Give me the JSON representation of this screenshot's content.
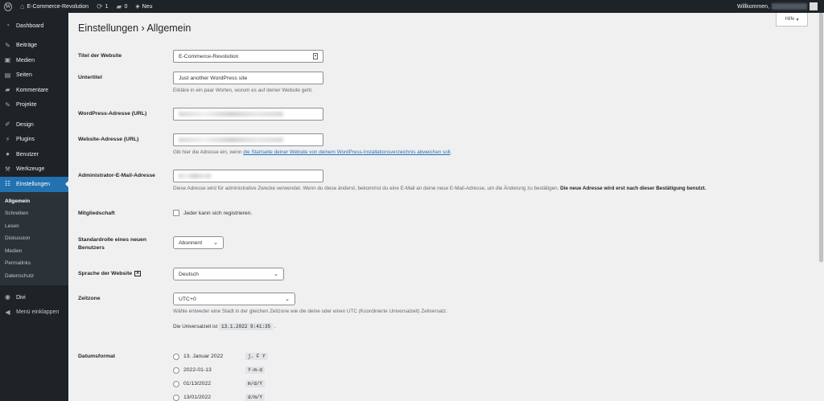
{
  "adminbar": {
    "site_name": "E-Commerce-Revolution",
    "updates_count": "1",
    "comments_count": "0",
    "new_label": "Neu",
    "welcome": "Willkommen,"
  },
  "sidebar": {
    "items": [
      {
        "label": "Dashboard",
        "icon": "dashboard-icon"
      },
      {
        "label": "Beiträge",
        "icon": "pin-icon"
      },
      {
        "label": "Medien",
        "icon": "media-icon"
      },
      {
        "label": "Seiten",
        "icon": "pages-icon"
      },
      {
        "label": "Kommentare",
        "icon": "comment-icon"
      },
      {
        "label": "Projekte",
        "icon": "pin-icon"
      },
      {
        "label": "Design",
        "icon": "brush-icon"
      },
      {
        "label": "Plugins",
        "icon": "plugin-icon"
      },
      {
        "label": "Benutzer",
        "icon": "user-icon"
      },
      {
        "label": "Werkzeuge",
        "icon": "wrench-icon"
      },
      {
        "label": "Einstellungen",
        "icon": "settings-icon"
      }
    ],
    "submenu": [
      "Allgemein",
      "Schreiben",
      "Lesen",
      "Diskussion",
      "Medien",
      "Permalinks",
      "Datenschutz"
    ],
    "divi": "Divi",
    "collapse": "Menü einklappen"
  },
  "help_tab": "Hilfe",
  "page_title": "Einstellungen › Allgemein",
  "form": {
    "site_title": {
      "label": "Titel der Website",
      "value": "E-Commerce-Revolution"
    },
    "tagline": {
      "label": "Untertitel",
      "value": "Just another WordPress site",
      "desc": "Erkläre in ein paar Worten, worum es auf deiner Website geht."
    },
    "wp_address": {
      "label": "WordPress-Adresse (URL)"
    },
    "site_address": {
      "label": "Website-Adresse (URL)",
      "desc_pre": "Gib hier die Adresse ein, wenn ",
      "desc_link": "die Startseite deiner Website von deinem WordPress-Installationsverzeichnis abweichen soll",
      "desc_post": "."
    },
    "admin_email": {
      "label": "Administrator-E-Mail-Adresse",
      "desc_pre": "Diese Adresse wird für administrative Zwecke verwendet. Wenn du diese änderst, bekommst du eine E-Mail an deine neue E-Mail-Adresse, um die Änderung zu bestätigen. ",
      "desc_bold": "Die neue Adresse wird erst nach dieser Bestätigung benutzt."
    },
    "membership": {
      "label": "Mitgliedschaft",
      "checkbox_label": "Jeder kann sich registrieren."
    },
    "default_role": {
      "label": "Standardrolle eines neuen Benutzers",
      "value": "Abonnent"
    },
    "language": {
      "label": "Sprache der Website",
      "value": "Deutsch"
    },
    "timezone": {
      "label": "Zeitzone",
      "value": "UTC+0",
      "desc": "Wähle entweder eine Stadt in der gleichen Zeitzone wie die deine oder einen UTC (Koordinierte Universalzeit) Zeitversatz.",
      "utc_pre": "Die Universalzeit ist",
      "utc_value": "13.1.2022 9:41:35",
      "utc_post": "."
    },
    "date_format": {
      "label": "Datumsformat",
      "options": [
        {
          "display": "13. Januar 2022",
          "code": "j. F Y"
        },
        {
          "display": "2022-01-13",
          "code": "Y-m-d"
        },
        {
          "display": "01/13/2022",
          "code": "m/d/Y"
        },
        {
          "display": "13/01/2022",
          "code": "d/m/Y"
        }
      ]
    }
  }
}
